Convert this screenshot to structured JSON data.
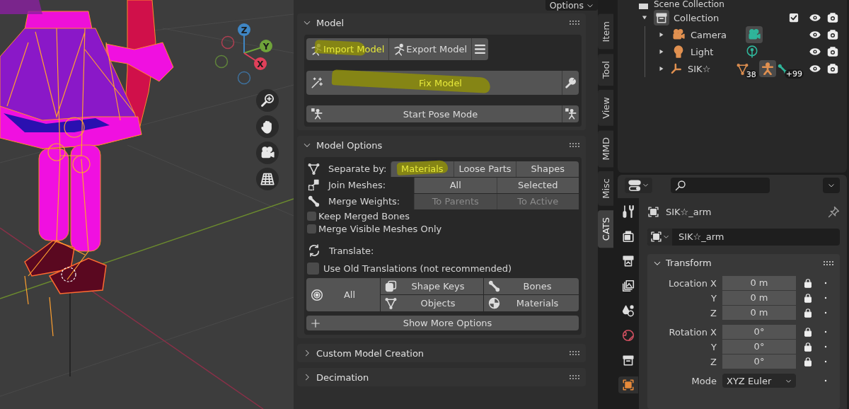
{
  "viewport": {
    "options_button": "Options",
    "axes": [
      {
        "label": "Z",
        "color": "#3f86c4"
      },
      {
        "label": "Y",
        "color": "#6fa33a"
      },
      {
        "label": "X",
        "color": "#e0405a"
      }
    ]
  },
  "model_panel": {
    "title": "Model",
    "expanded": true,
    "import_button": {
      "label": "Import Model",
      "highlighted": true
    },
    "export_button": {
      "label": "Export Model",
      "highlighted": false
    },
    "fix_button": {
      "label": "Fix Model",
      "highlighted": true
    },
    "pose_button": {
      "label": "Start Pose Mode"
    }
  },
  "model_options_panel": {
    "title": "Model Options",
    "expanded": true,
    "separate": {
      "label": "Separate by:",
      "options": [
        {
          "label": "Materials",
          "highlighted": true,
          "disabled": false
        },
        {
          "label": "Loose Parts",
          "highlighted": false,
          "disabled": false
        },
        {
          "label": "Shapes",
          "highlighted": false,
          "disabled": false
        }
      ]
    },
    "join": {
      "label": "Join Meshes:",
      "options": [
        {
          "label": "All",
          "highlighted": false,
          "disabled": false
        },
        {
          "label": "Selected",
          "highlighted": false,
          "disabled": false
        }
      ]
    },
    "merge": {
      "label": "Merge Weights:",
      "options": [
        {
          "label": "To Parents",
          "highlighted": false,
          "disabled": true
        },
        {
          "label": "To Active",
          "highlighted": false,
          "disabled": true
        }
      ]
    },
    "checkboxes": [
      {
        "label": "Keep Merged Bones",
        "checked": false
      },
      {
        "label": "Merge Visible Meshes Only",
        "checked": false
      }
    ],
    "translate_label": "Translate:",
    "old_translations": {
      "label": "Use Old Translations (not recommended)",
      "checked": false
    },
    "translate_all": "All",
    "translate_buttons": [
      {
        "label": "Shape Keys",
        "kind": "shapekeys"
      },
      {
        "label": "Bones",
        "kind": "bones"
      },
      {
        "label": "Objects",
        "kind": "objects"
      },
      {
        "label": "Materials",
        "kind": "materials"
      }
    ],
    "more_button": "Show More Options"
  },
  "more_panels": [
    {
      "title": "Custom Model Creation",
      "expanded": false
    },
    {
      "title": "Decimation",
      "expanded": false
    }
  ],
  "sidebar_tabs": [
    {
      "label": "Item",
      "selected": false
    },
    {
      "label": "Tool",
      "selected": false
    },
    {
      "label": "View",
      "selected": false
    },
    {
      "label": "MMD",
      "selected": false
    },
    {
      "label": "Misc",
      "selected": false
    },
    {
      "label": "CATS",
      "selected": true
    }
  ],
  "outliner": {
    "root": "Scene Collection",
    "collection": {
      "name": "Collection",
      "expanded": true,
      "checked": true
    },
    "items": [
      {
        "name": "Camera",
        "kind": "camera",
        "expanded": false
      },
      {
        "name": "Light",
        "kind": "light",
        "expanded": false
      },
      {
        "name": "SIK☆",
        "kind": "armature",
        "expanded": false,
        "mesh_count": "38",
        "bone_count": "+99"
      }
    ]
  },
  "properties": {
    "tabs": [
      {
        "kind": "tool",
        "selected": false
      },
      {
        "kind": "render",
        "selected": false
      },
      {
        "kind": "output",
        "selected": false
      },
      {
        "kind": "view_layer",
        "selected": false
      },
      {
        "kind": "scene",
        "selected": false
      },
      {
        "kind": "world",
        "selected": false
      },
      {
        "kind": "collection",
        "selected": false
      },
      {
        "kind": "object",
        "selected": true
      }
    ],
    "object_name": "SIK☆_arm",
    "name_field": "SIK☆_arm",
    "transform": {
      "title": "Transform",
      "expanded": true,
      "groups": [
        {
          "rows": [
            {
              "label": "Location X",
              "value": "0 m"
            },
            {
              "label": "Y",
              "value": "0 m"
            },
            {
              "label": "Z",
              "value": "0 m"
            }
          ]
        },
        {
          "rows": [
            {
              "label": "Rotation X",
              "value": "0°"
            },
            {
              "label": "Y",
              "value": "0°"
            },
            {
              "label": "Z",
              "value": "0°"
            }
          ]
        }
      ],
      "mode": {
        "label": "Mode",
        "value": "XYZ Euler"
      }
    }
  }
}
